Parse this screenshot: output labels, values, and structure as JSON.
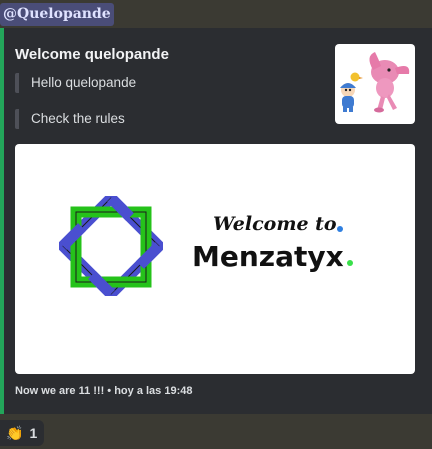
{
  "mention": "@Quelopande",
  "embed": {
    "accent_color": "#23a55a",
    "title": "Welcome quelopande",
    "lines": [
      "Hello quelopande",
      "Check the rules"
    ],
    "thumbnail_icon": "pocoyo-characters-image",
    "banner": {
      "welcome_text": "Welcome to",
      "server_name": "Menzatyx",
      "logo_icon": "menzatyx-logo"
    },
    "footer": "Now we are 11 !!! • hoy a las 19:48"
  },
  "reaction": {
    "emoji": "👏",
    "count": "1"
  }
}
